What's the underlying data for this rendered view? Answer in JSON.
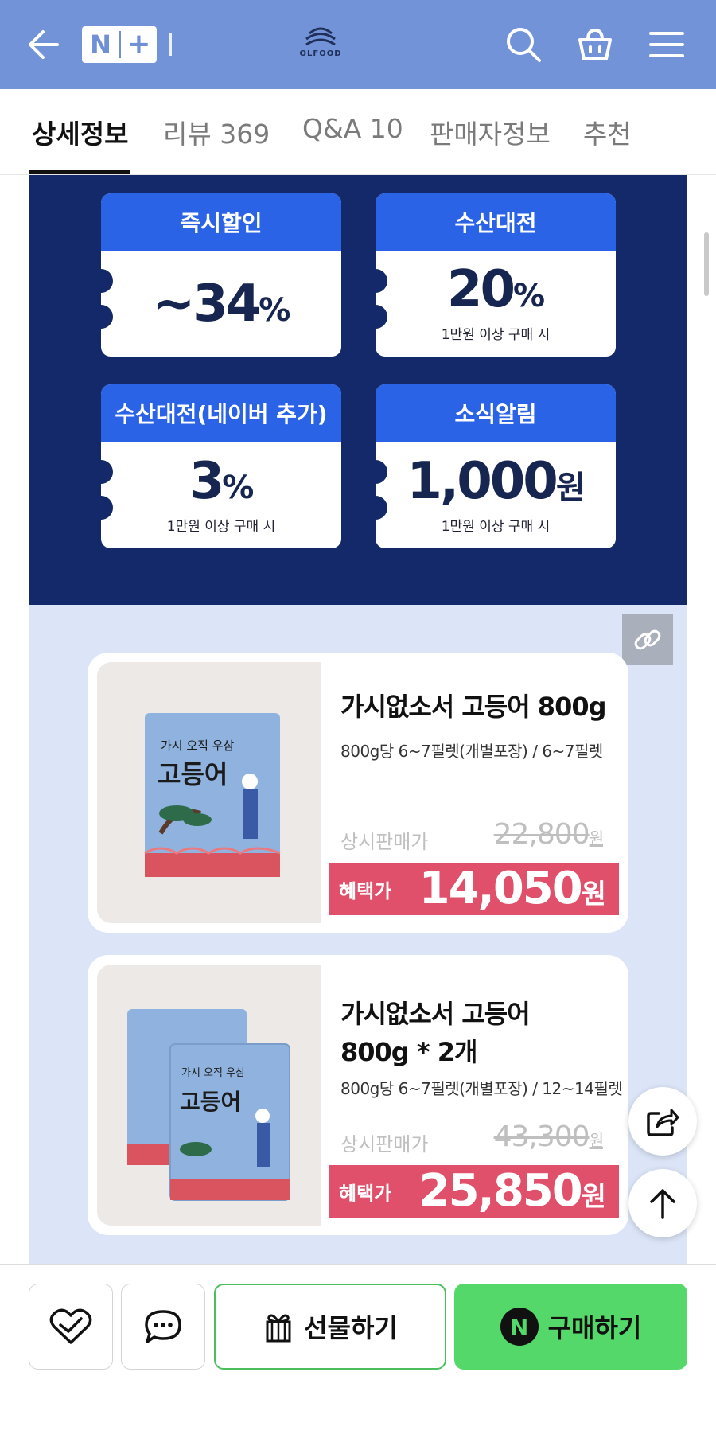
{
  "header": {
    "nplus_n": "N",
    "nplus_plus": "+",
    "logo_text": "OLFOOD",
    "icons": [
      "back-arrow-icon",
      "search-icon",
      "cart-icon",
      "menu-icon"
    ]
  },
  "tabs": [
    {
      "label": "상세정보",
      "active": true
    },
    {
      "label": "리뷰 369",
      "active": false
    },
    {
      "label": "Q&A 10",
      "active": false
    },
    {
      "label": "판매자정보",
      "active": false
    },
    {
      "label": "추천",
      "active": false
    }
  ],
  "coupons": [
    {
      "title": "즉시할인",
      "value": "~34",
      "unit": "%",
      "sub": ""
    },
    {
      "title": "수산대전",
      "value": "20",
      "unit": "%",
      "sub": "1만원 이상 구매 시"
    },
    {
      "title": "수산대전(네이버 추가)",
      "value": "3",
      "unit": "%",
      "sub": "1만원 이상 구매 시"
    },
    {
      "title": "소식알림",
      "value": "1,000",
      "unit": "원",
      "sub": "1만원 이상 구매 시"
    }
  ],
  "products": [
    {
      "title": "가시없소서 고등어 800g",
      "spec": "800g당 6~7필렛(개별포장) / 6~7필렛",
      "list_label": "상시판매가",
      "list_price": "22,800",
      "list_unit": "원",
      "benefit_label": "혜택가",
      "benefit_price": "14,050",
      "benefit_unit": "원",
      "package_text": "고등어",
      "package_top": "가시 오직 우삼"
    },
    {
      "title_line1": "가시없소서 고등어",
      "title_line2": "800g * 2개",
      "spec": "800g당 6~7필렛(개별포장) / 12~14필렛",
      "list_label": "상시판매가",
      "list_price": "43,300",
      "list_unit": "원",
      "benefit_label": "혜택가",
      "benefit_price": "25,850",
      "benefit_unit": "원",
      "package_text": "고등어",
      "package_top": "가시 오직 우삼"
    }
  ],
  "bottom_bar": {
    "gift_label": "선물하기",
    "buy_label": "구매하기",
    "npay_letter": "N"
  },
  "colors": {
    "header_bg": "#7393d8",
    "coupon_bg": "#13296a",
    "coupon_head": "#2b63e6",
    "product_bg": "#dbe5f7",
    "benefit_bg": "#e0506a",
    "buy_green": "#55d86a"
  }
}
